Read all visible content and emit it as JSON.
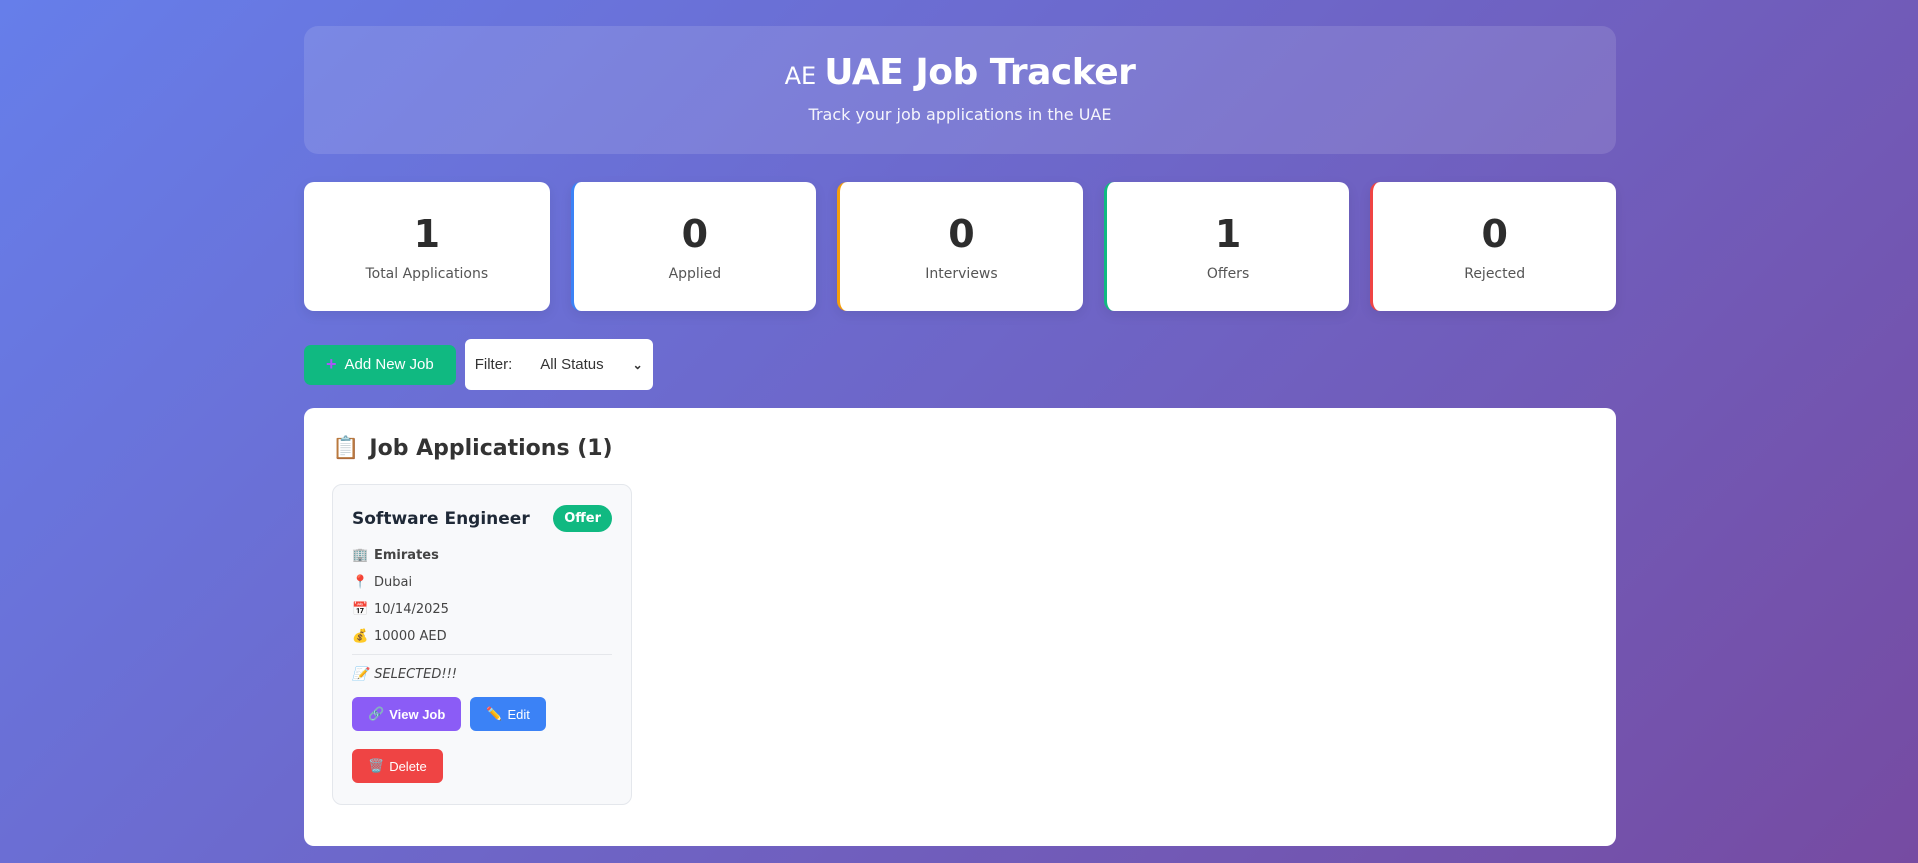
{
  "header": {
    "flag_text": "AE",
    "title": "UAE Job Tracker",
    "subtitle": "Track your job applications in the UAE"
  },
  "stats": [
    {
      "value": "1",
      "label": "Total Applications"
    },
    {
      "value": "0",
      "label": "Applied"
    },
    {
      "value": "0",
      "label": "Interviews"
    },
    {
      "value": "1",
      "label": "Offers"
    },
    {
      "value": "0",
      "label": "Rejected"
    }
  ],
  "toolbar": {
    "add_icon": "plus-icon",
    "add_label": "Add New Job",
    "filter_label": "Filter:",
    "filter_value": "All Status"
  },
  "panel": {
    "title_icon": "clipboard-icon",
    "title": "Job Applications (1)"
  },
  "jobs": [
    {
      "title": "Software Engineer",
      "status": "Offer",
      "company": "Emirates",
      "location": "Dubai",
      "date": "10/14/2025",
      "salary": "10000 AED",
      "notes": "SELECTED!!!",
      "view_label": "View Job",
      "edit_label": "Edit",
      "delete_label": "Delete"
    }
  ],
  "colors": {
    "bg_start": "#667eea",
    "bg_end": "#764ba2",
    "applied": "#3b82f6",
    "interviews": "#f59e0b",
    "offers": "#10b981",
    "rejected": "#ef4444",
    "view": "#8b5cf6"
  }
}
